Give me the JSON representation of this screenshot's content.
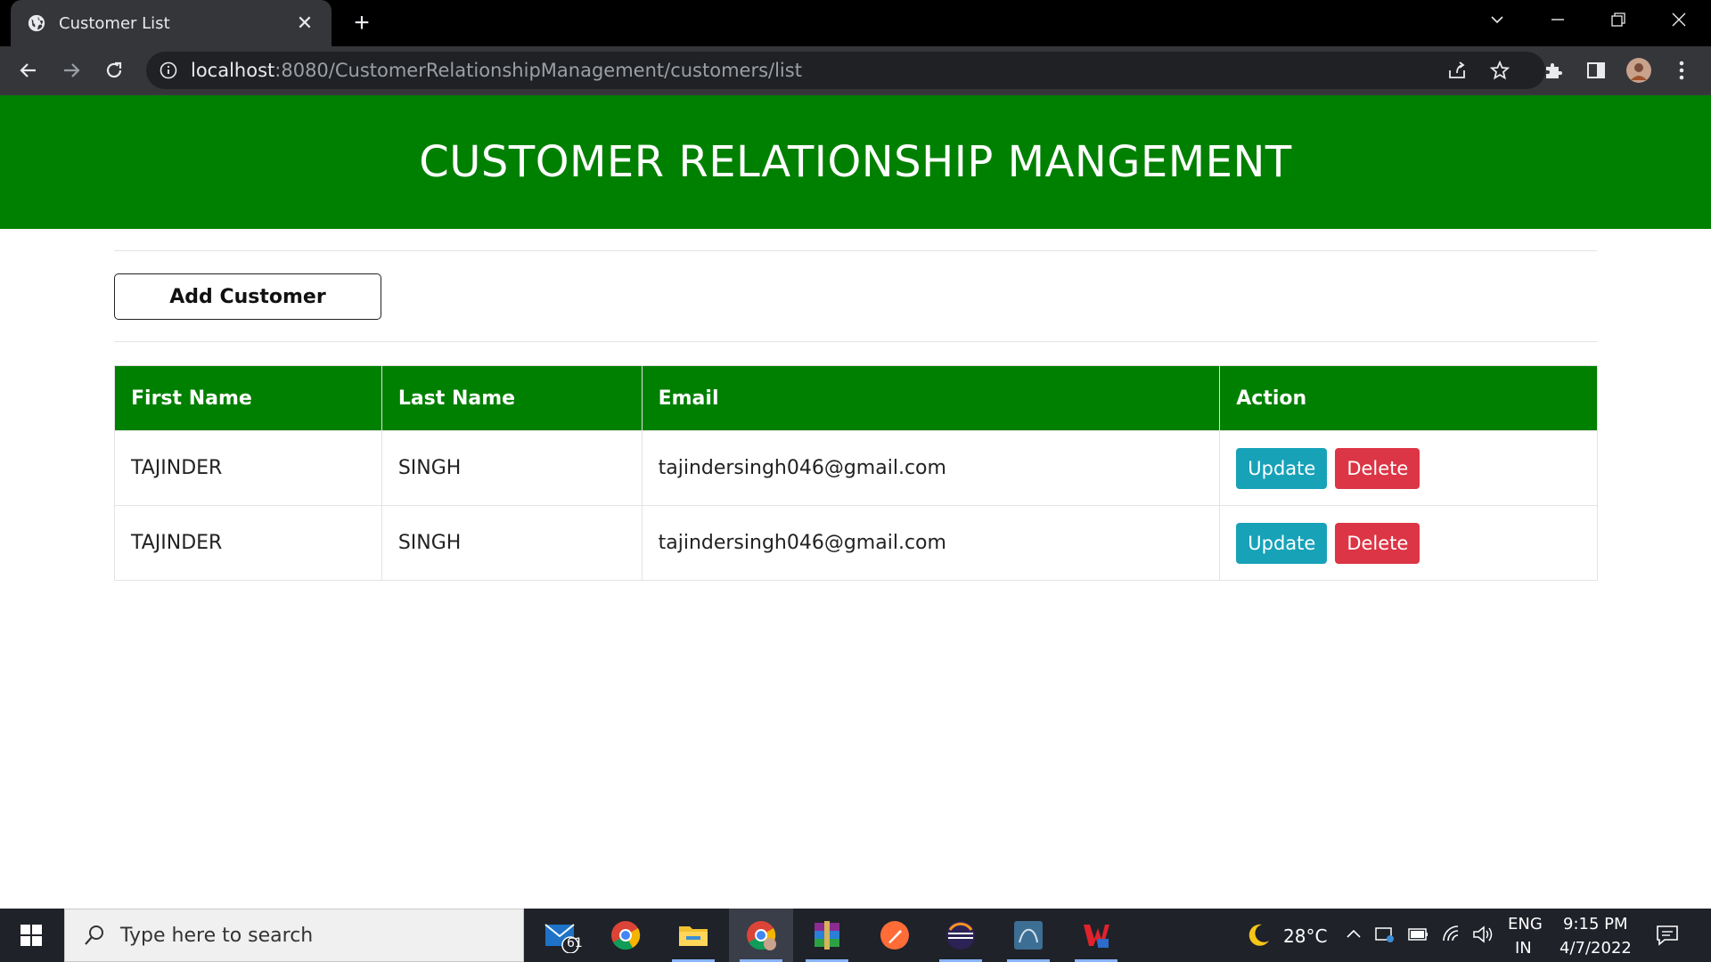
{
  "browser": {
    "tab_title": "Customer List",
    "url_host": "localhost",
    "url_path": ":8080/CustomerRelationshipManagement/customers/list"
  },
  "page": {
    "heading": "CUSTOMER RELATIONSHIP MANGEMENT",
    "add_button": "Add Customer",
    "table": {
      "headers": [
        "First Name",
        "Last Name",
        "Email",
        "Action"
      ],
      "rows": [
        {
          "first": "TAJINDER",
          "last": "SINGH",
          "email": "tajindersingh046@gmail.com",
          "update": "Update",
          "delete": "Delete"
        },
        {
          "first": "TAJINDER",
          "last": "SINGH",
          "email": "tajindersingh046@gmail.com",
          "update": "Update",
          "delete": "Delete"
        }
      ]
    }
  },
  "taskbar": {
    "search_placeholder": "Type here to search",
    "mail_badge": "61",
    "weather": "28°C",
    "language": "ENG",
    "region": "IN",
    "time": "9:15 PM",
    "date": "4/7/2022"
  },
  "colors": {
    "brand_green": "#008000",
    "update": "#17a2b8",
    "delete": "#dc3545"
  }
}
